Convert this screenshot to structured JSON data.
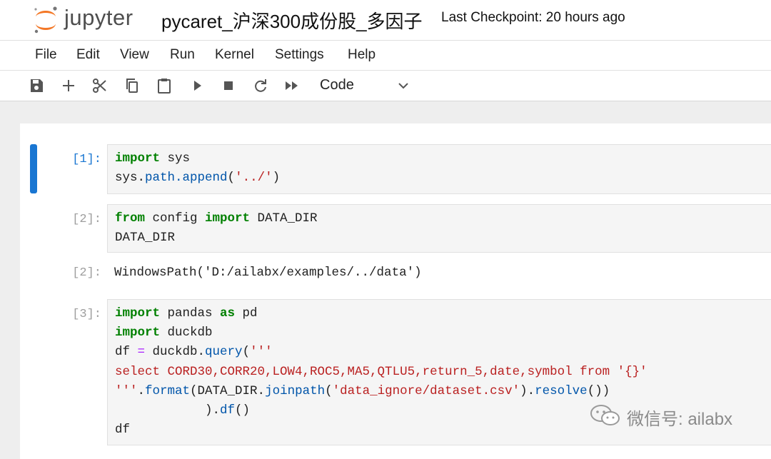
{
  "header": {
    "logo_text": "jupyter",
    "notebook_title": "pycaret_沪深300成份股_多因子",
    "checkpoint": "Last Checkpoint: 20 hours ago"
  },
  "menubar": {
    "file": "File",
    "edit": "Edit",
    "view": "View",
    "run": "Run",
    "kernel": "Kernel",
    "settings": "Settings",
    "help": "Help"
  },
  "toolbar": {
    "icons": [
      "save-icon",
      "add-icon",
      "cut-icon",
      "copy-icon",
      "paste-icon",
      "run-icon",
      "stop-icon",
      "restart-icon",
      "fast-forward-icon"
    ],
    "cell_type": "Code"
  },
  "cells": {
    "c1": {
      "prompt": "[1]:",
      "l1_kw": "import",
      "l1_rest": " sys",
      "l2_a": "sys.",
      "l2_attr": "path.append",
      "l2_b": "(",
      "l2_str": "'../'",
      "l2_c": ")"
    },
    "c2": {
      "prompt": "[2]:",
      "l1_kw1": "from",
      "l1_mid": " config ",
      "l1_kw2": "import",
      "l1_rest": " DATA_DIR",
      "l2": "DATA_DIR",
      "out_prompt": "[2]:",
      "output": "WindowsPath('D:/ailabx/examples/../data')"
    },
    "c3": {
      "prompt": "[3]:",
      "l1_kw": "import",
      "l1_mid": " pandas ",
      "l1_kw2": "as",
      "l1_rest": " pd",
      "l2_kw": "import",
      "l2_rest": " duckdb",
      "l3_a": "df ",
      "l3_op": "=",
      "l3_b": " duckdb.",
      "l3_attr": "query",
      "l3_c": "(",
      "l3_str": "'''",
      "l4_str": "select CORD30,CORR20,LOW4,ROC5,MA5,QTLU5,return_5,date,symbol from '{}'",
      "l5_str": "'''",
      "l5_a": ".",
      "l5_attr": "format",
      "l5_b": "(DATA_DIR.",
      "l5_attr2": "joinpath",
      "l5_c": "(",
      "l5_str2": "'data_ignore/dataset.csv'",
      "l5_d": ").",
      "l5_attr3": "resolve",
      "l5_e": "())",
      "l6_a": "            ).",
      "l6_attr": "df",
      "l6_b": "()",
      "l7": "df"
    }
  },
  "watermark": {
    "text": "微信号: ailabx"
  }
}
